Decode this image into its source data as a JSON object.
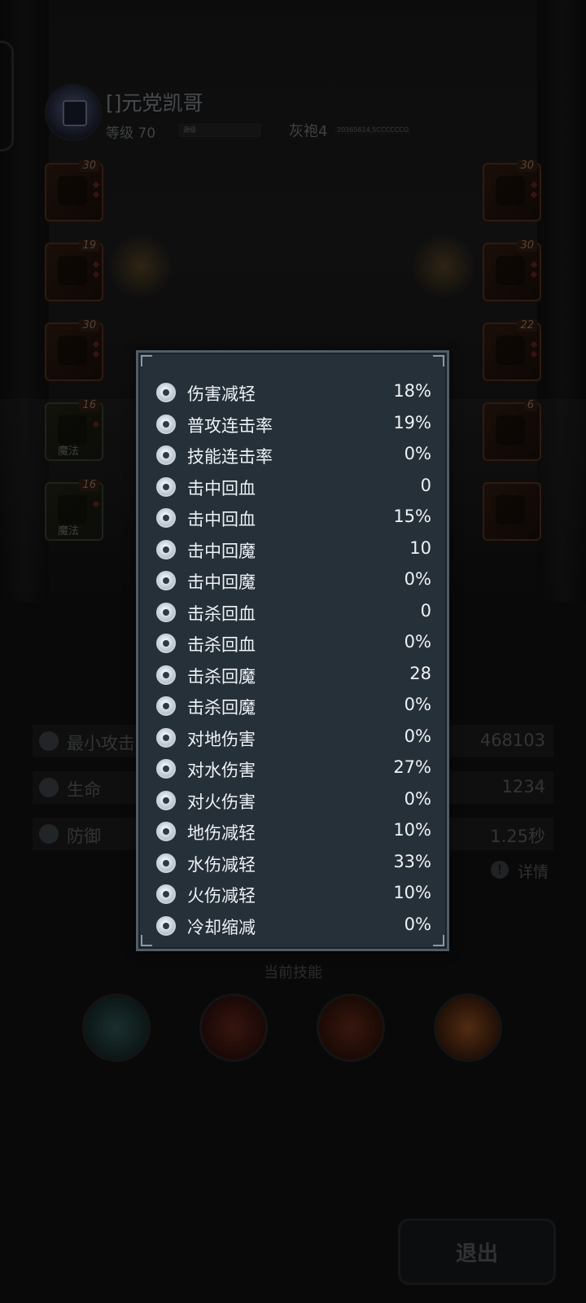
{
  "player": {
    "name": "[]元党凯哥",
    "level_text": "等级 70",
    "exp_label": "源级",
    "robe_text": "灰袍4",
    "robe_id": "20365614,5CCCCCCO"
  },
  "equipment_left": [
    {
      "level": "30",
      "tag": ""
    },
    {
      "level": "19",
      "tag": ""
    },
    {
      "level": "30",
      "tag": ""
    },
    {
      "level": "16",
      "tag": "魔法"
    },
    {
      "level": "16",
      "tag": "魔法"
    }
  ],
  "equipment_right": [
    {
      "level": "30"
    },
    {
      "level": "30"
    },
    {
      "level": "22"
    },
    {
      "level": "6"
    },
    {
      "level": ""
    }
  ],
  "base_stats": [
    {
      "icon": "sword-icon",
      "label": "最小攻击",
      "value": "468103"
    },
    {
      "icon": "heart-icon",
      "label": "生命",
      "value": "1234"
    },
    {
      "icon": "shield-icon",
      "label": "防御",
      "value": "1.25秒"
    }
  ],
  "detail_label": "详情",
  "skills_title": "当前技能",
  "exit_label": "退出",
  "popup": {
    "attributes": [
      {
        "icon": "armor-icon",
        "label": "伤害减轻",
        "value": "18%"
      },
      {
        "icon": "combo-icon",
        "label": "普攻连击率",
        "value": "19%"
      },
      {
        "icon": "skill-combo-icon",
        "label": "技能连击率",
        "value": "0%"
      },
      {
        "icon": "hit-heal-icon",
        "label": "击中回血",
        "value": "0"
      },
      {
        "icon": "hit-heal-icon",
        "label": "击中回血",
        "value": "15%"
      },
      {
        "icon": "hit-mana-icon",
        "label": "击中回魔",
        "value": "10"
      },
      {
        "icon": "hit-mana-icon",
        "label": "击中回魔",
        "value": "0%"
      },
      {
        "icon": "kill-heal-icon",
        "label": "击杀回血",
        "value": "0"
      },
      {
        "icon": "kill-heal-icon",
        "label": "击杀回血",
        "value": "0%"
      },
      {
        "icon": "kill-mana-icon",
        "label": "击杀回魔",
        "value": "28"
      },
      {
        "icon": "kill-mana-icon",
        "label": "击杀回魔",
        "value": "0%"
      },
      {
        "icon": "earth-icon",
        "label": "对地伤害",
        "value": "0%"
      },
      {
        "icon": "water-icon",
        "label": "对水伤害",
        "value": "27%"
      },
      {
        "icon": "fire-icon",
        "label": "对火伤害",
        "value": "0%"
      },
      {
        "icon": "earth-resist-icon",
        "label": "地伤减轻",
        "value": "10%"
      },
      {
        "icon": "water-resist-icon",
        "label": "水伤减轻",
        "value": "33%"
      },
      {
        "icon": "fire-resist-icon",
        "label": "火伤减轻",
        "value": "10%"
      },
      {
        "icon": "hourglass-icon",
        "label": "冷却缩减",
        "value": "0%"
      }
    ]
  },
  "colors": {
    "panel_bg": "#263038",
    "panel_border": "#4f5d67",
    "text": "#eef2f5"
  }
}
